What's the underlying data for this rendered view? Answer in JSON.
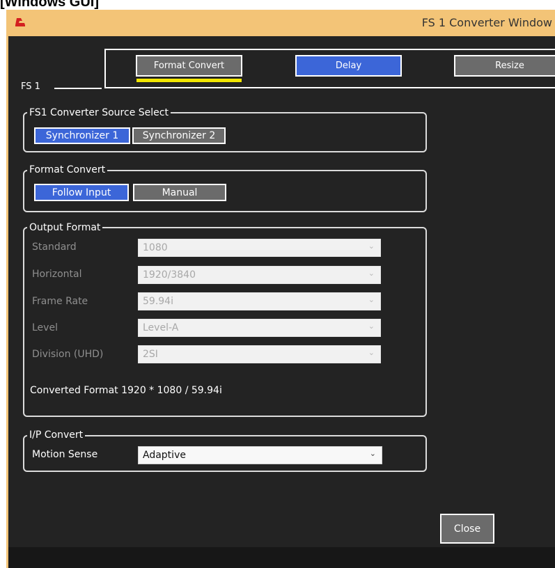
{
  "caption": "[Windows GUI]",
  "window": {
    "title": "FS 1 Converter Window",
    "icon": "app-logo-icon",
    "accent_color": "#f3c477"
  },
  "fs_label": "FS 1",
  "tabs": [
    {
      "label": "Format Convert",
      "selected": true
    },
    {
      "label": "Delay",
      "selected": false
    },
    {
      "label": "Resize",
      "selected": false
    }
  ],
  "source_select": {
    "title": "FS1 Converter Source Select",
    "options": [
      "Synchronizer 1",
      "Synchronizer 2"
    ],
    "selected": "Synchronizer 1"
  },
  "format_convert": {
    "title": "Format Convert",
    "options": [
      "Follow Input",
      "Manual"
    ],
    "selected": "Follow Input"
  },
  "output_format": {
    "title": "Output Format",
    "fields": [
      {
        "label": "Standard",
        "value": "1080"
      },
      {
        "label": "Horizontal",
        "value": "1920/3840"
      },
      {
        "label": "Frame Rate",
        "value": "59.94i"
      },
      {
        "label": "Level",
        "value": "Level-A"
      },
      {
        "label": "Division (UHD)",
        "value": "2SI"
      }
    ],
    "converted": "Converted Format 1920 * 1080 / 59.94i"
  },
  "ip_convert": {
    "title": "I/P Convert",
    "label": "Motion Sense",
    "value": "Adaptive"
  },
  "close_label": "Close",
  "colors": {
    "blue": "#3c66d8",
    "gray": "#6b6b6b",
    "background": "#232323",
    "underline": "#f2e600"
  }
}
